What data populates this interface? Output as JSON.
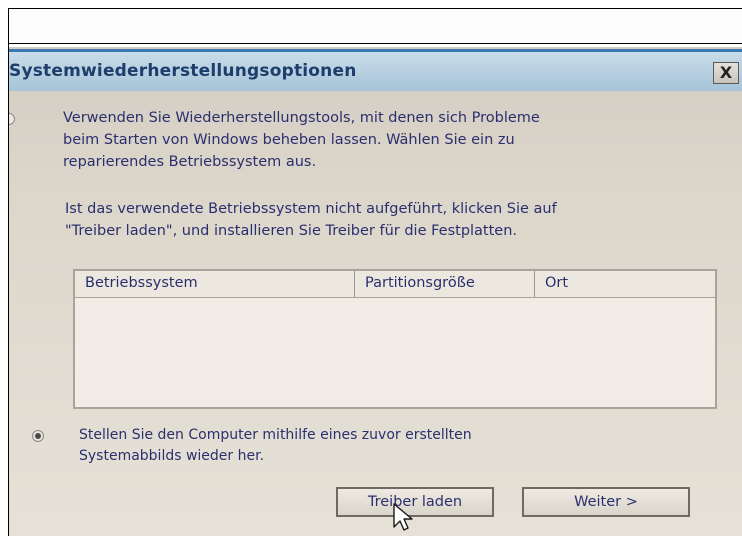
{
  "dialog": {
    "title": "Systemwiederherstellungsoptionen",
    "close_label": "X"
  },
  "option1": {
    "text_line1": "Verwenden Sie Wiederherstellungstools, mit denen sich Probleme",
    "text_line2": "beim Starten von Windows beheben lassen. Wählen Sie ein zu",
    "text_line3": "reparierendes Betriebssystem aus.",
    "selected": false
  },
  "instruction": {
    "line1": "Ist das verwendete Betriebssystem nicht aufgeführt, klicken Sie auf",
    "line2": "\"Treiber laden\", und installieren Sie Treiber für die Festplatten."
  },
  "table": {
    "columns": [
      "Betriebssystem",
      "Partitionsgröße",
      "Ort"
    ],
    "rows": []
  },
  "option2": {
    "text_line1": "Stellen Sie den Computer mithilfe eines zuvor erstellten",
    "text_line2": "Systemabbilds wieder her.",
    "selected": true
  },
  "buttons": {
    "load_drivers": "Treiber laden",
    "next": "Weiter >"
  }
}
